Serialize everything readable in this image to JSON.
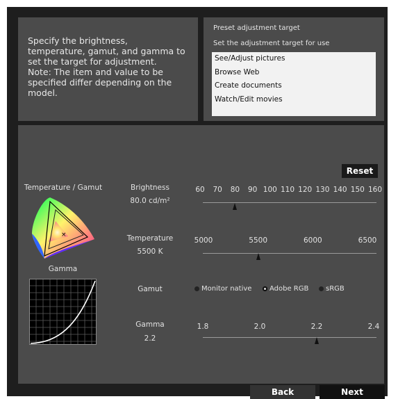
{
  "intro": {
    "lines": [
      "Specify the brightness,",
      "temperature, gamut, and gamma to",
      "set the target for adjustment.",
      "Note: The item and value to be",
      "specified differ depending on the",
      "model."
    ]
  },
  "preset": {
    "title": "Preset adjustment target",
    "subtitle": "Set the adjustment target for use",
    "items": [
      "See/Adjust pictures",
      "Browse Web",
      "Create documents",
      "Watch/Edit movies"
    ]
  },
  "reset_label": "Reset",
  "left": {
    "temp_gamut_label": "Temperature / Gamut",
    "gamma_label": "Gamma"
  },
  "brightness": {
    "label": "Brightness",
    "value": "80.0 cd/m²",
    "ticks": [
      "60",
      "70",
      "80",
      "90",
      "100",
      "110",
      "120",
      "130",
      "140",
      "150",
      "160"
    ],
    "setting": 80
  },
  "temperature": {
    "label": "Temperature",
    "value": "5500 K",
    "ticks": [
      "5000",
      "5500",
      "6000",
      "6500"
    ],
    "setting": 5500
  },
  "gamut": {
    "label": "Gamut",
    "options": [
      "Monitor native",
      "Adobe RGB",
      "sRGB"
    ],
    "selected": "Adobe RGB"
  },
  "gamma": {
    "label": "Gamma",
    "value": "2.2",
    "ticks": [
      "1.8",
      "2.0",
      "2.2",
      "2.4"
    ],
    "setting": 2.2
  },
  "footer": {
    "back": "Back",
    "next": "Next"
  },
  "icons": [
    "cie-chromaticity-diagram-icon",
    "gamma-curve-graph-icon",
    "slider-thumb-icon"
  ],
  "colors": {
    "panel": "#4b4b4b",
    "frame": "#1e1e1e",
    "list_bg": "#f2f2f2"
  }
}
